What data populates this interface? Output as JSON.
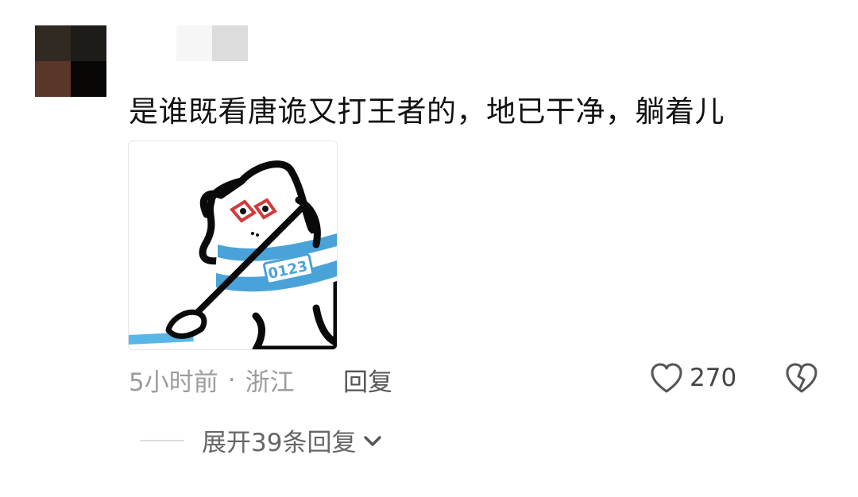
{
  "comment": {
    "avatar_colors": [
      "#302a22",
      "#1e1c18",
      "#5a3628",
      "#090706"
    ],
    "username_blur_colors": [
      "#f6f6f6",
      "#dcdcdc"
    ],
    "text": "是谁既看唐诡又打王者的，地已干净，躺着儿",
    "sticker": {
      "icon": "cat-mopping-sticker",
      "badge_text": "0123",
      "accent": "#4aa3d8"
    },
    "time": "5小时前",
    "separator": "·",
    "location": "浙江",
    "reply_label": "回复",
    "like_count": "270",
    "expand_label": "展开39条回复"
  },
  "colors": {
    "text_primary": "#111111",
    "text_meta": "#9c9c9c",
    "icon": "#555555"
  }
}
